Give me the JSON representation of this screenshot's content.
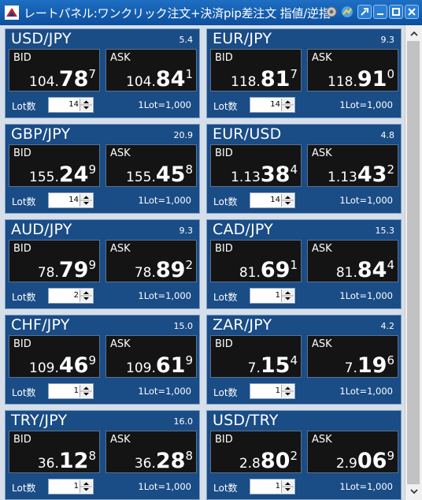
{
  "window": {
    "title": "レートパネル:ワンクリック注文+決済pip差注文 指値/逆指",
    "icons": [
      "app-logo-icon",
      "settings-icon",
      "chart-icon",
      "pin-icon",
      "minimize-icon",
      "maximize-icon",
      "close-icon"
    ]
  },
  "colors": {
    "card_bg": "#1a4c86",
    "quote_bg": "#141414",
    "titlebar": "#1565b8"
  },
  "labels": {
    "bid": "BID",
    "ask": "ASK",
    "lot": "Lot数",
    "lot_info": "1Lot=1,000"
  },
  "pairs": [
    {
      "pair": "USD/JPY",
      "spread": "5.4",
      "bid": {
        "pre": "104.",
        "big": "78",
        "pip": "7"
      },
      "ask": {
        "pre": "104.",
        "big": "84",
        "pip": "1"
      },
      "lot": "14"
    },
    {
      "pair": "EUR/JPY",
      "spread": "9.3",
      "bid": {
        "pre": "118.",
        "big": "81",
        "pip": "7"
      },
      "ask": {
        "pre": "118.",
        "big": "91",
        "pip": "0"
      },
      "lot": "14"
    },
    {
      "pair": "GBP/JPY",
      "spread": "20.9",
      "bid": {
        "pre": "155.",
        "big": "24",
        "pip": "9"
      },
      "ask": {
        "pre": "155.",
        "big": "45",
        "pip": "8"
      },
      "lot": "14"
    },
    {
      "pair": "EUR/USD",
      "spread": "4.8",
      "bid": {
        "pre": "1.13",
        "big": "38",
        "pip": "4"
      },
      "ask": {
        "pre": "1.13",
        "big": "43",
        "pip": "2"
      },
      "lot": "14"
    },
    {
      "pair": "AUD/JPY",
      "spread": "9.3",
      "bid": {
        "pre": "78.",
        "big": "79",
        "pip": "9"
      },
      "ask": {
        "pre": "78.",
        "big": "89",
        "pip": "2"
      },
      "lot": "2"
    },
    {
      "pair": "CAD/JPY",
      "spread": "15.3",
      "bid": {
        "pre": "81.",
        "big": "69",
        "pip": "1"
      },
      "ask": {
        "pre": "81.",
        "big": "84",
        "pip": "4"
      },
      "lot": "1"
    },
    {
      "pair": "CHF/JPY",
      "spread": "15.0",
      "bid": {
        "pre": "109.",
        "big": "46",
        "pip": "9"
      },
      "ask": {
        "pre": "109.",
        "big": "61",
        "pip": "9"
      },
      "lot": "1"
    },
    {
      "pair": "ZAR/JPY",
      "spread": "4.2",
      "bid": {
        "pre": "7.",
        "big": "15",
        "pip": "4"
      },
      "ask": {
        "pre": "7.",
        "big": "19",
        "pip": "6"
      },
      "lot": "1"
    },
    {
      "pair": "TRY/JPY",
      "spread": "16.0",
      "bid": {
        "pre": "36.",
        "big": "12",
        "pip": "8"
      },
      "ask": {
        "pre": "36.",
        "big": "28",
        "pip": "8"
      },
      "lot": "1"
    },
    {
      "pair": "USD/TRY",
      "spread": "",
      "bid": {
        "pre": "2.8",
        "big": "80",
        "pip": "2"
      },
      "ask": {
        "pre": "2.9",
        "big": "06",
        "pip": "9"
      },
      "lot": "1"
    }
  ]
}
